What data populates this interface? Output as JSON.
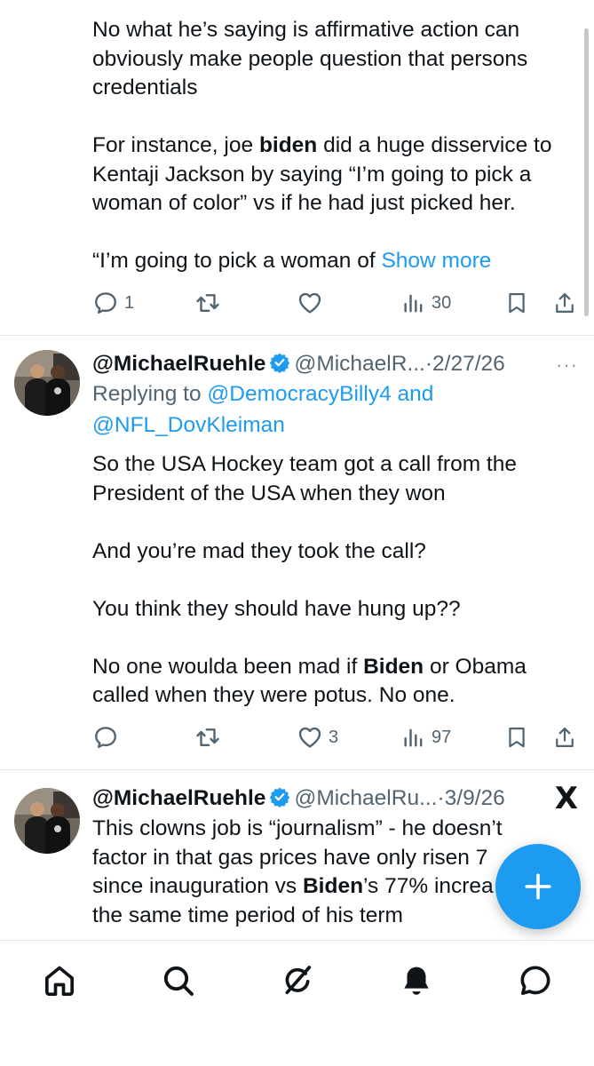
{
  "tweets": [
    {
      "paragraphs": [
        [
          "No what he’s saying is affirmative action can obviously make people question that persons credentials"
        ],
        [
          "For instance, joe ",
          "biden",
          " did a huge disservice to Kentaji Jackson by saying “I’m going to pick a woman of color” vs if he had just picked her."
        ],
        [
          "“I’m going to pick a woman of "
        ]
      ],
      "show_more": "Show more",
      "actions": {
        "replies": "1",
        "reposts": "",
        "likes": "",
        "views": "30"
      }
    },
    {
      "author_name": "@MichaelRuehle",
      "author_handle": "@MichaelR...",
      "separator": "·",
      "date": "2/27/26",
      "more_icon": "···",
      "replying_prefix": "Replying to ",
      "replying_to_1": "@DemocracyBilly4",
      "replying_and": " and",
      "replying_to_2": "@NFL_DovKleiman",
      "paragraphs": [
        [
          "So the USA Hockey team got a call from the President of the USA when they won"
        ],
        [
          "And you’re mad they took the call?"
        ],
        [
          "You think they should have hung up??"
        ],
        [
          "No one woulda been mad if ",
          "Biden",
          " or Obama called when they were potus.  No one."
        ]
      ],
      "actions": {
        "replies": "",
        "reposts": "",
        "likes": "3",
        "views": "97"
      }
    },
    {
      "author_name": "@MichaelRuehle",
      "author_handle": "@MichaelRu...",
      "separator": "·",
      "date": "3/9/26",
      "x_icon": "X",
      "line1": "This clowns job is “journalism” - he doesn’t",
      "line2": "factor in that gas prices have only risen 7",
      "line3_a": "since inauguration vs ",
      "line3_b": "Biden",
      "line3_c": "’s 77% increa",
      "line4": "the same time period of his term"
    }
  ],
  "icons": {
    "reply": "reply-icon",
    "repost": "repost-icon",
    "like": "heart-icon",
    "views": "views-icon",
    "bookmark": "bookmark-icon",
    "share": "share-icon",
    "compose": "plus-icon",
    "tabs": [
      "home-icon",
      "search-icon",
      "grok-icon",
      "notifications-icon",
      "messages-icon"
    ]
  },
  "colors": {
    "accent": "#1d9bf0",
    "text": "#0f1419",
    "muted": "#536471",
    "verified": "#1d9bf0"
  }
}
